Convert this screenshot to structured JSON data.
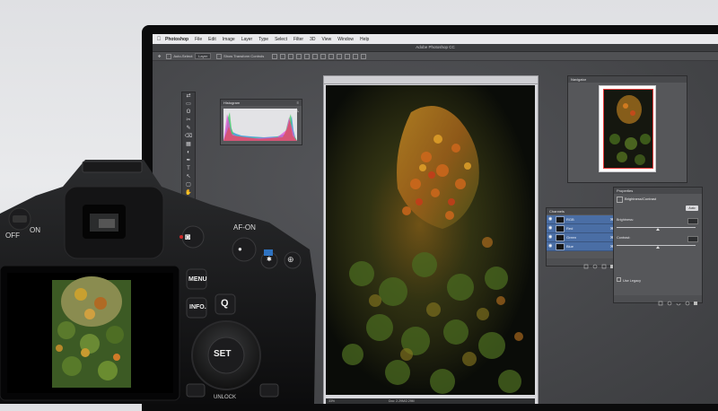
{
  "menubar": {
    "apple": "",
    "items": [
      "Photoshop",
      "File",
      "Edit",
      "Image",
      "Layer",
      "Type",
      "Select",
      "Filter",
      "3D",
      "View",
      "Window",
      "Help"
    ]
  },
  "window": {
    "title": "Adobe Photoshop CC"
  },
  "options_bar": {
    "auto_select": "Auto-Select:",
    "auto_select_value": "Layer",
    "show_transform": "Show Transform Controls"
  },
  "tools": [
    "⇄",
    "▭",
    "ʘ",
    "✂",
    "✎",
    "⌫",
    "▦",
    "◐",
    "✒",
    "T",
    "↖",
    "▢",
    "✋",
    "🔍",
    "◼",
    "◻"
  ],
  "histogram": {
    "title": "Histogram",
    "warn": "⚠"
  },
  "document": {
    "zoom": "33%",
    "doc": "Doc: 2.29M/2.29M"
  },
  "navigator": {
    "title": "Navigator"
  },
  "channels": {
    "title": "Channels",
    "rows": [
      {
        "label": "RGB",
        "key": "⌘2"
      },
      {
        "label": "Red",
        "key": "⌘3"
      },
      {
        "label": "Green",
        "key": "⌘4"
      },
      {
        "label": "Blue",
        "key": "⌘5"
      }
    ]
  },
  "properties": {
    "title": "Properties",
    "adjustment": "Brightness/Contrast",
    "auto": "Auto",
    "brightness_label": "Brightness:",
    "contrast_label": "Contrast:",
    "legacy": "Use Legacy"
  },
  "camera": {
    "labels": {
      "off": "OFF",
      "on": "ON",
      "af_on": "AF-ON",
      "menu": "MENU",
      "info": "INFO.",
      "set": "SET",
      "unlock": "UNLOCK",
      "q": "Q"
    }
  },
  "colors": {
    "accent_selection": "#4a6ea5",
    "panel_bg": "#56575a",
    "navigator_frame": "#e83a3a"
  }
}
